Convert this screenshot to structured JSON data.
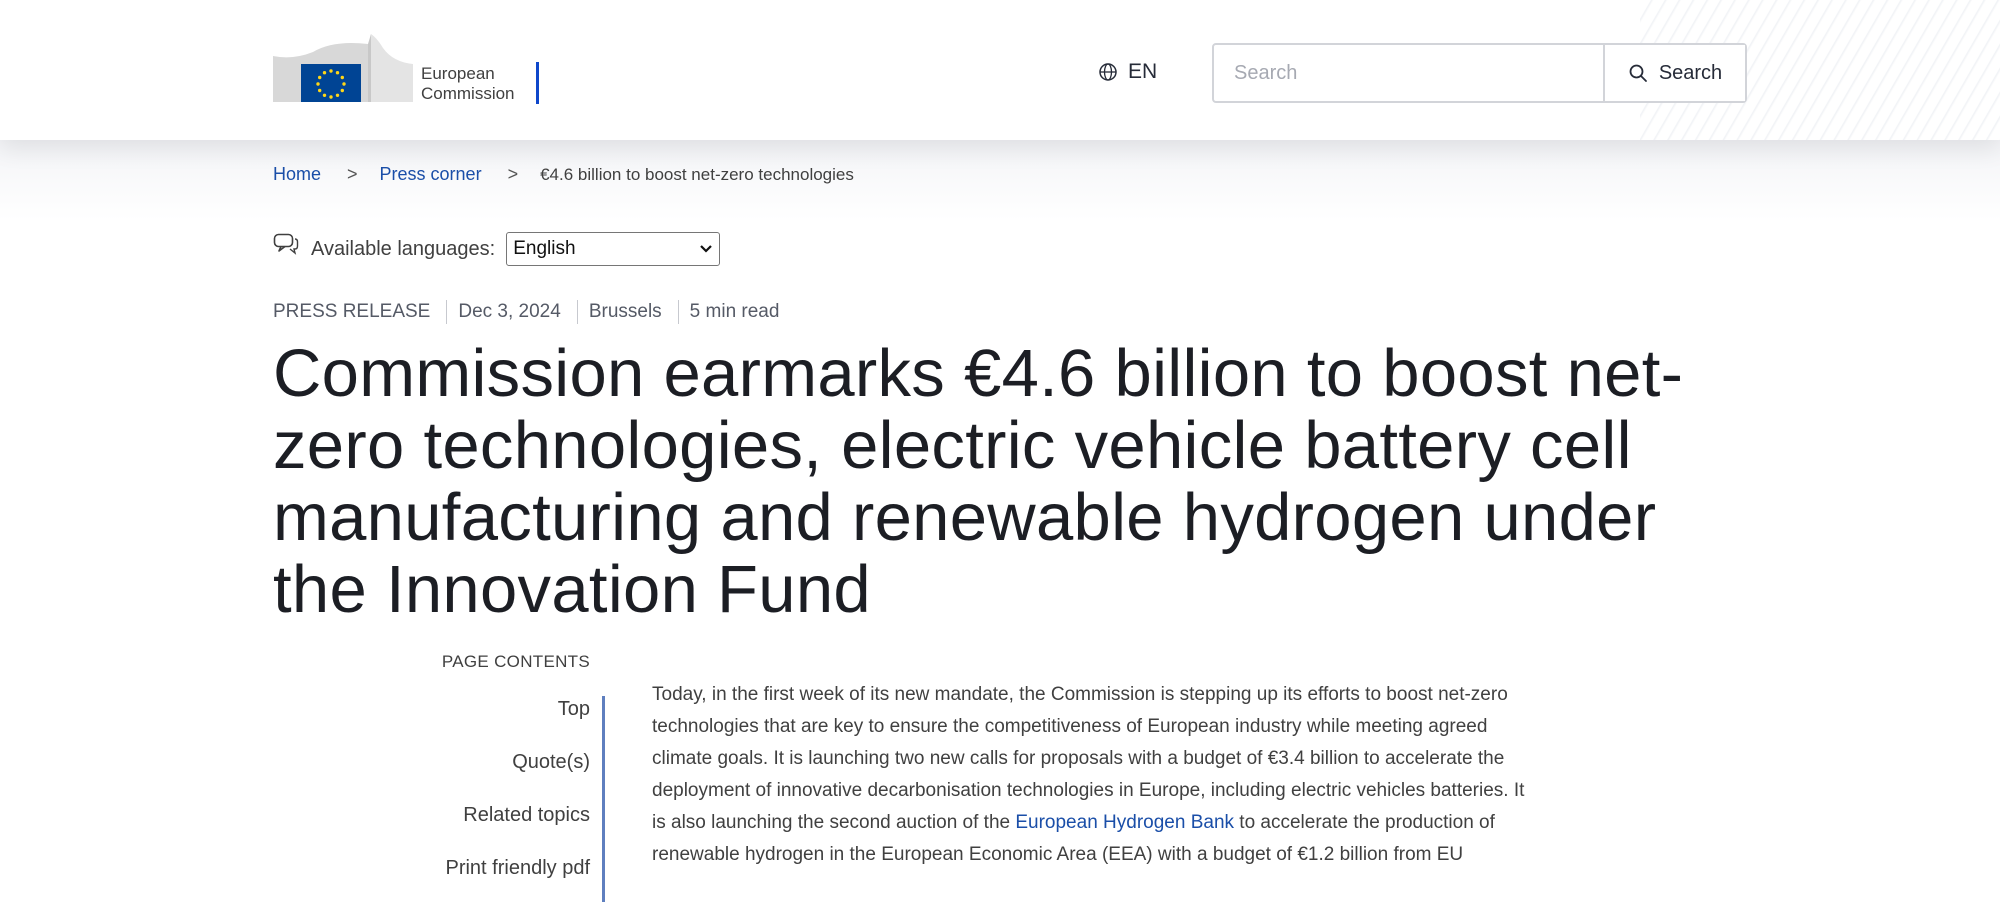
{
  "header": {
    "logo_text_line1": "European",
    "logo_text_line2": "Commission",
    "language_code": "EN",
    "search_placeholder": "Search",
    "search_button_label": "Search"
  },
  "breadcrumb": {
    "items": [
      "Home",
      "Press corner"
    ],
    "current": "€4.6 billion to boost net-zero technologies"
  },
  "languages": {
    "label": "Available languages:",
    "selected": "English"
  },
  "meta": {
    "type": "PRESS RELEASE",
    "date": "Dec 3, 2024",
    "location": "Brussels",
    "read_time": "5 min read"
  },
  "title": "Commission earmarks €4.6 billion to boost net-zero technologies, electric vehicle battery cell manufacturing and renewable hydrogen under the Innovation Fund",
  "page_contents": {
    "heading": "PAGE CONTENTS",
    "items": [
      "Top",
      "Quote(s)",
      "Related topics",
      "Print friendly pdf"
    ]
  },
  "body": {
    "text_before_link": "Today, in the first week of its new mandate, the Commission is stepping up its efforts to boost net-zero technologies that are key to ensure the competitiveness of European industry while meeting agreed climate goals. It is launching two new calls for proposals with a budget of €3.4 billion to accelerate the deployment of innovative decarbonisation technologies in Europe, including electric vehicles batteries. It is also launching the second auction of the ",
    "link_text": "European Hydrogen Bank",
    "text_after_link": " to accelerate the production of renewable hydrogen in the European Economic Area (EEA) with a budget of €1.2 billion from EU"
  },
  "colors": {
    "link": "#1a4ea8",
    "eu_blue": "#0e47cb",
    "eu_flag_blue": "#004494",
    "eu_star_yellow": "#ffd617",
    "toc_line": "#5f7fbf"
  },
  "icons": {
    "language": "globe-icon",
    "search": "search-icon",
    "languages": "speech-bubble-icon",
    "select": "chevron-down-icon"
  }
}
